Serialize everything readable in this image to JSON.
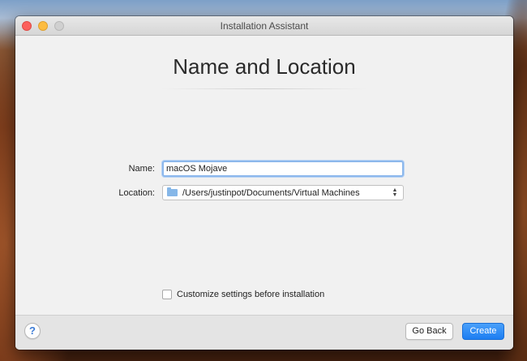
{
  "window": {
    "title": "Installation Assistant"
  },
  "main": {
    "heading": "Name and Location",
    "name_label": "Name:",
    "name_value": "macOS Mojave",
    "location_label": "Location:",
    "location_value": "/Users/justinpot/Documents/Virtual Machines",
    "customize_label": "Customize settings before installation",
    "customize_checked": false
  },
  "footer": {
    "help_label": "?",
    "back_label": "Go Back",
    "create_label": "Create"
  },
  "icons": {
    "location": "folder-icon",
    "select": "up-down-chevron-icon"
  },
  "colors": {
    "accent": "#1d7ef2",
    "focus_ring": "#8db8ec",
    "close": "#fc605c",
    "minimize": "#fdbc40"
  }
}
